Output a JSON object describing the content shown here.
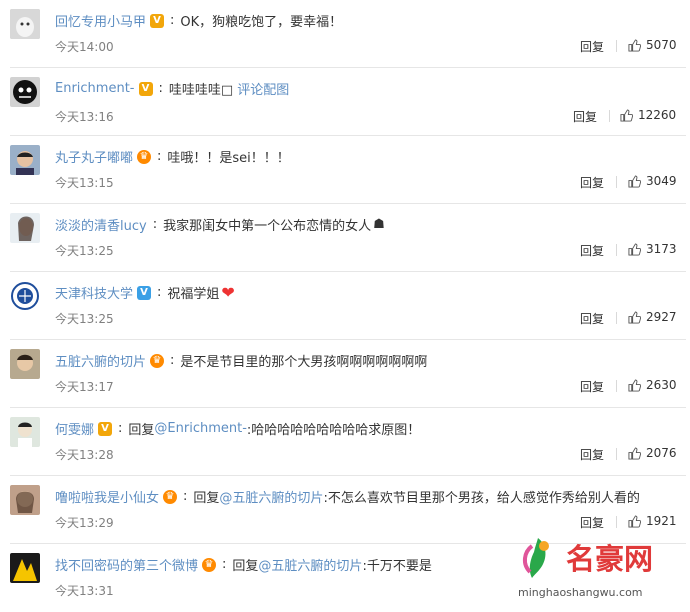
{
  "colors": {
    "username_orange": "#eb7350",
    "link_blue": "#5e8ec2",
    "time_gray": "#808080",
    "watermark_red": "#e03a3a"
  },
  "reply_label": "回复",
  "comments": [
    {
      "user": "回忆专用小马甲",
      "badge": "gold",
      "text": "OK，狗粮吃饱了，要幸福！",
      "time": "今天14:00",
      "likes": "5070",
      "name_color": "blue"
    },
    {
      "user": "Enrichment-",
      "badge": "gold-v",
      "text": "哇哇哇哇□",
      "link": "评论配图",
      "time": "今天13:16",
      "likes": "12260",
      "name_color": "blue"
    },
    {
      "user": "丸子丸子嘟嘟",
      "badge": "crown",
      "text": "哇哦！！是sei！！！",
      "time": "今天13:15",
      "likes": "3049",
      "name_color": "blue"
    },
    {
      "user": "淡淡的清香lucy",
      "badge": "",
      "text": "我家那闺女中第一个公布恋情的女人",
      "time": "今天13:25",
      "likes": "3173",
      "name_color": "blue"
    },
    {
      "user": "天津科技大学",
      "badge": "blue-v",
      "text": "祝福学姐",
      "time": "今天13:25",
      "likes": "2927",
      "name_color": "blue"
    },
    {
      "user": "五脏六腑的切片",
      "badge": "crown",
      "text": "是不是节目里的那个大男孩啊啊啊啊啊啊啊",
      "time": "今天13:17",
      "likes": "2630",
      "name_color": "blue"
    },
    {
      "user": "何雯娜",
      "badge": "gold-v",
      "reply_prefix": "回复",
      "mention": "@Enrichment-",
      "text": ":哈哈哈哈哈哈哈哈哈求原图！",
      "time": "今天13:28",
      "likes": "2076",
      "name_color": "blue"
    },
    {
      "user": "噜啦啦我是小仙女",
      "badge": "crown",
      "reply_prefix": "回复",
      "mention": "@五脏六腑的切片",
      "text": ":不怎么喜欢节目里那个男孩，给人感觉作秀给别人看的",
      "time": "今天13:29",
      "likes": "1921",
      "name_color": "blue"
    },
    {
      "user": "找不回密码的第三个微博",
      "badge": "crown",
      "reply_prefix": "回复",
      "mention": "@五脏六腑的切片",
      "text": ":千万不要是",
      "time": "今天13:31",
      "likes": "",
      "name_color": "blue"
    }
  ],
  "watermark": {
    "title": "名豪网",
    "url": "minghaoshangwu.com"
  }
}
